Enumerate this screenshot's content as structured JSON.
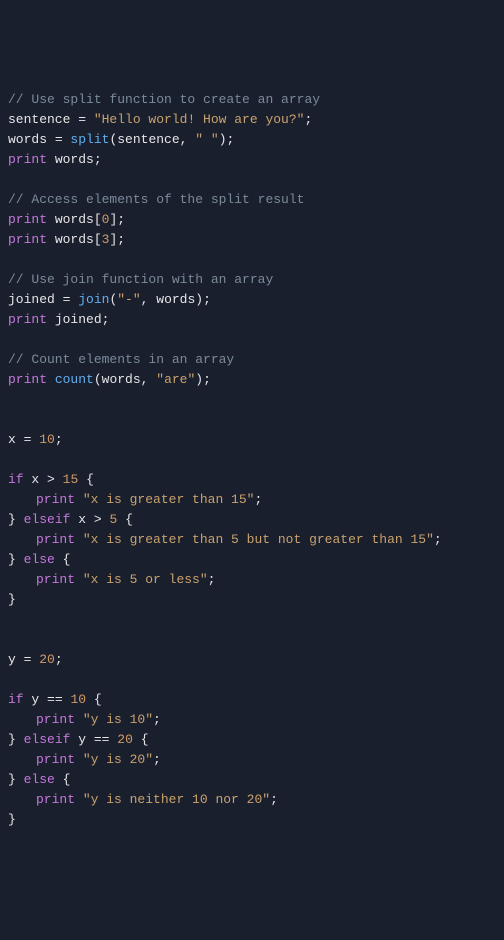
{
  "lines": {
    "c1": "// Use split function to create an array",
    "l2_ident": "sentence",
    "l2_eq": " = ",
    "l2_str": "\"Hello world! How are you?\"",
    "l2_semi": ";",
    "l3_ident": "words",
    "l3_eq": " = ",
    "l3_func": "split",
    "l3_p_open": "(",
    "l3_arg1": "sentence",
    "l3_comma": ", ",
    "l3_arg2": "\" \"",
    "l3_p_close": ")",
    "l3_semi": ";",
    "l4_kw": "print",
    "l4_sp": " ",
    "l4_ident": "words",
    "l4_semi": ";",
    "c2": "// Access elements of the split result",
    "l6_kw": "print",
    "l6_sp": " ",
    "l6_ident": "words",
    "l6_br": "[",
    "l6_idx": "0",
    "l6_br2": "]",
    "l6_semi": ";",
    "l7_kw": "print",
    "l7_sp": " ",
    "l7_ident": "words",
    "l7_br": "[",
    "l7_idx": "3",
    "l7_br2": "]",
    "l7_semi": ";",
    "c3": "// Use join function with an array",
    "l9_ident": "joined",
    "l9_eq": " = ",
    "l9_func": "join",
    "l9_p_open": "(",
    "l9_arg1": "\"-\"",
    "l9_comma": ", ",
    "l9_arg2": "words",
    "l9_p_close": ")",
    "l9_semi": ";",
    "l10_kw": "print",
    "l10_sp": " ",
    "l10_ident": "joined",
    "l10_semi": ";",
    "c4": "// Count elements in an array",
    "l12_kw": "print",
    "l12_sp": " ",
    "l12_func": "count",
    "l12_p_open": "(",
    "l12_arg1": "words",
    "l12_comma": ", ",
    "l12_arg2": "\"are\"",
    "l12_p_close": ")",
    "l12_semi": ";",
    "l14_ident": "x",
    "l14_eq": " = ",
    "l14_num": "10",
    "l14_semi": ";",
    "l16_kw": "if",
    "l16_sp": " ",
    "l16_ident": "x",
    "l16_op": " > ",
    "l16_num": "15",
    "l16_sp2": " ",
    "l16_brace": "{",
    "l17_kw": "print",
    "l17_sp": " ",
    "l17_str": "\"x is greater than 15\"",
    "l17_semi": ";",
    "l18_brace": "}",
    "l18_sp": " ",
    "l18_kw": "elseif",
    "l18_sp2": " ",
    "l18_ident": "x",
    "l18_op": " > ",
    "l18_num": "5",
    "l18_sp3": " ",
    "l18_brace2": "{",
    "l19_kw": "print",
    "l19_sp": " ",
    "l19_str": "\"x is greater than 5 but not greater than 15\"",
    "l19_semi": ";",
    "l20_brace": "}",
    "l20_sp": " ",
    "l20_kw": "else",
    "l20_sp2": " ",
    "l20_brace2": "{",
    "l21_kw": "print",
    "l21_sp": " ",
    "l21_str": "\"x is 5 or less\"",
    "l21_semi": ";",
    "l22_brace": "}",
    "l24_ident": "y",
    "l24_eq": " = ",
    "l24_num": "20",
    "l24_semi": ";",
    "l26_kw": "if",
    "l26_sp": " ",
    "l26_ident": "y",
    "l26_op": " == ",
    "l26_num": "10",
    "l26_sp2": " ",
    "l26_brace": "{",
    "l27_kw": "print",
    "l27_sp": " ",
    "l27_str": "\"y is 10\"",
    "l27_semi": ";",
    "l28_brace": "}",
    "l28_sp": " ",
    "l28_kw": "elseif",
    "l28_sp2": " ",
    "l28_ident": "y",
    "l28_op": " == ",
    "l28_num": "20",
    "l28_sp3": " ",
    "l28_brace2": "{",
    "l29_kw": "print",
    "l29_sp": " ",
    "l29_str": "\"y is 20\"",
    "l29_semi": ";",
    "l30_brace": "}",
    "l30_sp": " ",
    "l30_kw": "else",
    "l30_sp2": " ",
    "l30_brace2": "{",
    "l31_kw": "print",
    "l31_sp": " ",
    "l31_str": "\"y is neither 10 nor 20\"",
    "l31_semi": ";",
    "l32_brace": "}"
  }
}
